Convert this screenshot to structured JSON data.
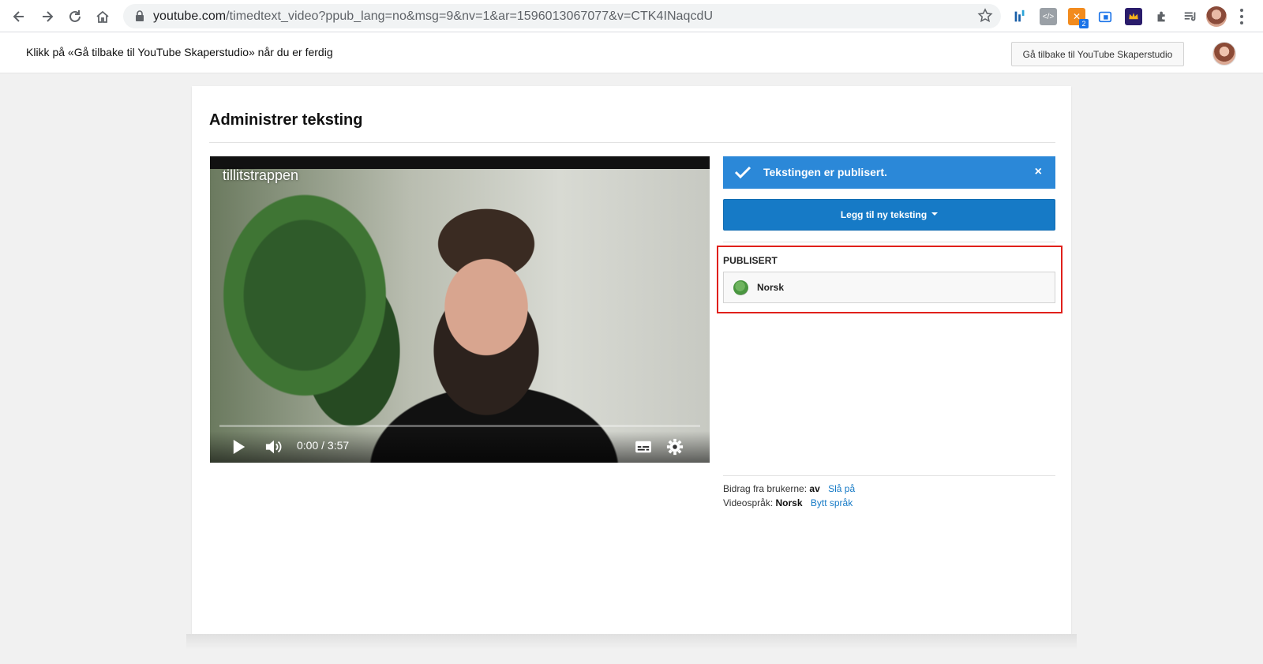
{
  "browser": {
    "url_host": "youtube.com",
    "url_rest": "/timedtext_video?ppub_lang=no&msg=9&nv=1&ar=1596013067077&v=CTK4INaqcdU",
    "extension_badge": "2"
  },
  "message_bar": {
    "text": "Klikk på «Gå tilbake til YouTube Skaperstudio» når du er ferdig",
    "back_button": "Gå tilbake til YouTube Skaperstudio"
  },
  "page": {
    "title": "Administrer teksting"
  },
  "video": {
    "title": "tillitstrappen",
    "time": "0:00 / 3:57",
    "progress": 0
  },
  "alert": {
    "text": "Tekstingen er publisert.",
    "close": "×",
    "color": "#2b88d8"
  },
  "add_button": {
    "label": "Legg til ny teksting"
  },
  "published": {
    "label": "PUBLISERT",
    "tracks": [
      {
        "name": "Norsk"
      }
    ]
  },
  "meta": {
    "contrib_label": "Bidrag fra brukerne:",
    "contrib_value": "av",
    "contrib_link": "Slå på",
    "lang_label": "Videospråk:",
    "lang_value": "Norsk",
    "lang_link": "Bytt språk"
  },
  "colors": {
    "primary_button": "#167ac6",
    "highlight_border": "#e0201b",
    "link": "#167ac6"
  }
}
